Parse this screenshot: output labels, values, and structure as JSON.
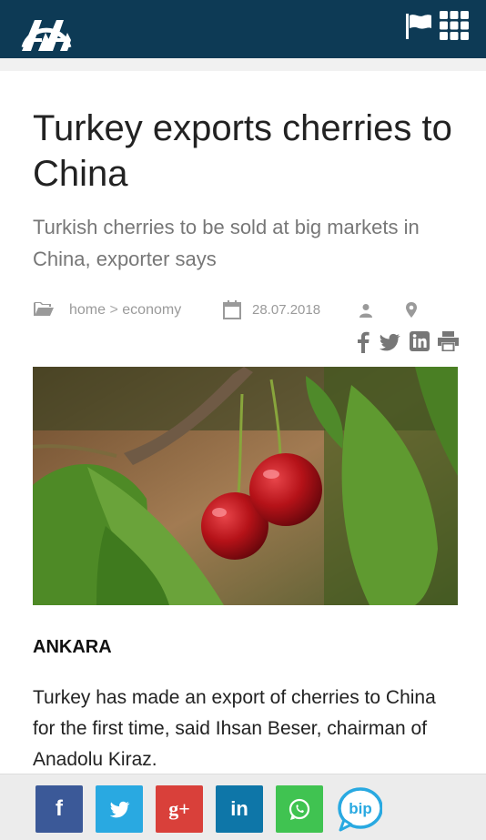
{
  "header": {
    "logo_text": "AA",
    "flag_icon": "flag-icon",
    "menu_icon": "grid-menu-icon",
    "bg_color": "#0d3a55"
  },
  "article": {
    "title": "Turkey exports cherries to China",
    "subtitle": "Turkish cherries to be sold at big markets in China, exporter says",
    "breadcrumb": {
      "home": "home",
      "separator": ">",
      "section": "economy"
    },
    "date": "28.07.2018",
    "meta_icons": [
      "folder-icon",
      "calendar-icon",
      "user-icon",
      "map-pin-icon"
    ],
    "share_icons": [
      "facebook-icon",
      "twitter-icon",
      "linkedin-icon",
      "print-icon"
    ],
    "image_subject": "cherry-photo",
    "dateline": "ANKARA",
    "lead": "Turkey has made an export of cherries to China for the first time, said Ihsan Beser, chairman of Anadolu Kiraz."
  },
  "share_bar": {
    "buttons": [
      {
        "label": "f",
        "icon": "facebook-icon",
        "color": "#3b5998"
      },
      {
        "label": "",
        "icon": "twitter-icon",
        "color": "#29a9e1"
      },
      {
        "label": "g+",
        "icon": "google-plus-icon",
        "color": "#d9403a"
      },
      {
        "label": "in",
        "icon": "linkedin-icon",
        "color": "#0e76a8"
      },
      {
        "label": "",
        "icon": "whatsapp-icon",
        "color": "#40c351"
      },
      {
        "label": "bip",
        "icon": "bip-icon",
        "color": "#29a9e1"
      }
    ]
  }
}
